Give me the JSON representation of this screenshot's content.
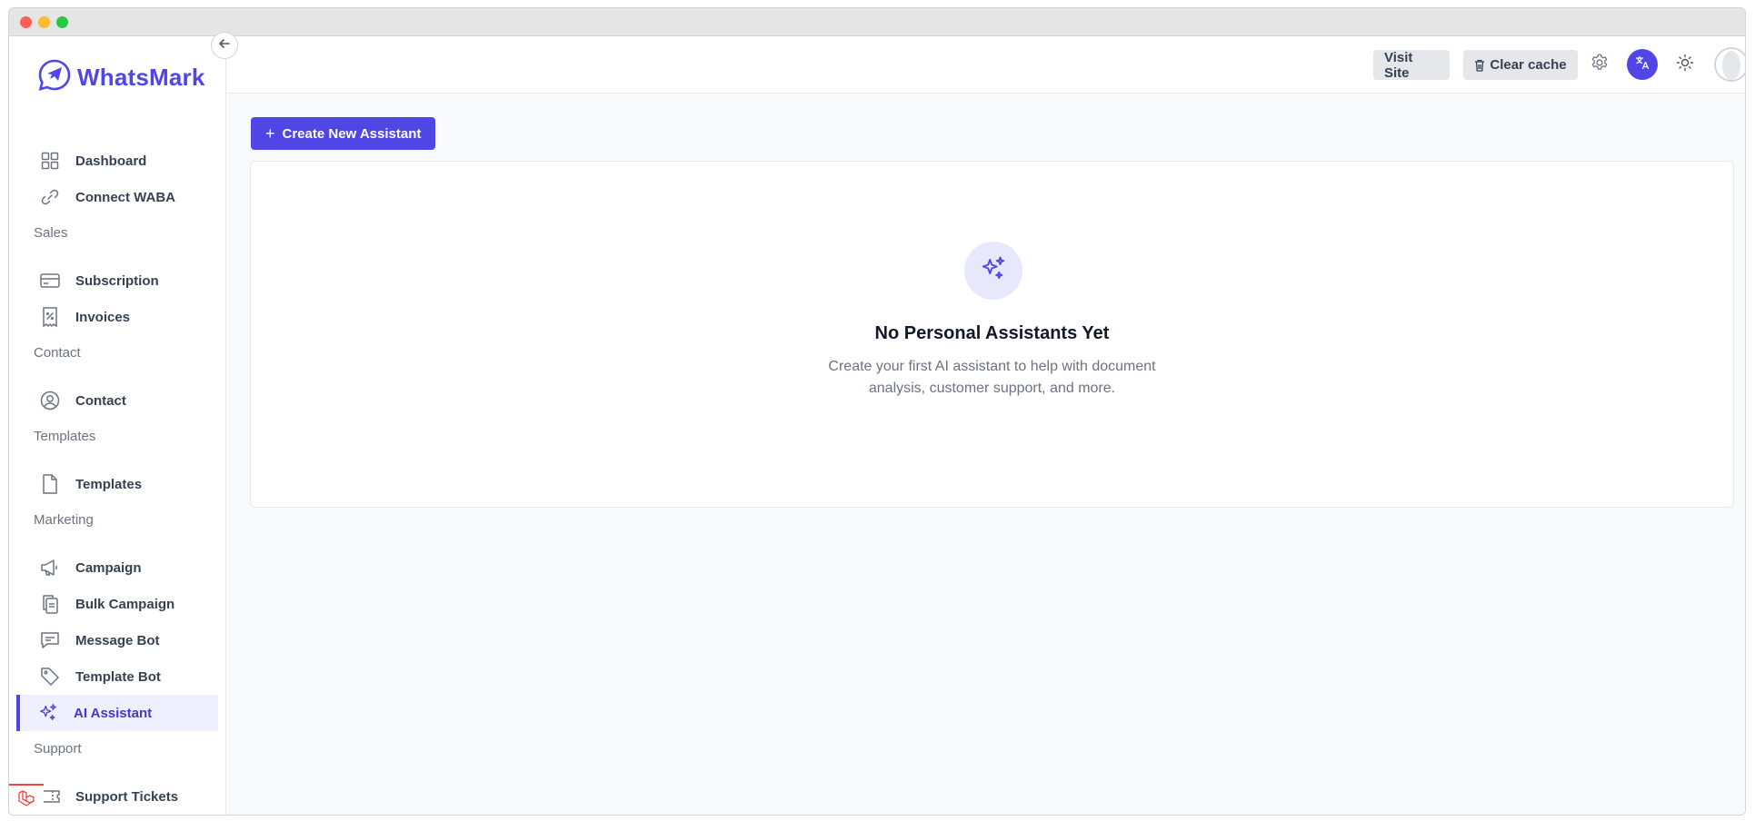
{
  "brand": {
    "name": "WhatsMark",
    "accent": "#4f46e5"
  },
  "sidebar": {
    "items": [
      {
        "key": "dashboard",
        "label": "Dashboard",
        "icon": "grid-icon"
      },
      {
        "key": "connect-waba",
        "label": "Connect WABA",
        "icon": "link-icon"
      },
      {
        "key": "sales-section",
        "label": "Sales",
        "type": "section"
      },
      {
        "key": "subscription",
        "label": "Subscription",
        "icon": "credit-card-icon"
      },
      {
        "key": "invoices",
        "label": "Invoices",
        "icon": "receipt-icon"
      },
      {
        "key": "contact-section",
        "label": "Contact",
        "type": "section"
      },
      {
        "key": "contact",
        "label": "Contact",
        "icon": "user-circle-icon"
      },
      {
        "key": "templates-section",
        "label": "Templates",
        "type": "section"
      },
      {
        "key": "templates",
        "label": "Templates",
        "icon": "document-icon"
      },
      {
        "key": "marketing-section",
        "label": "Marketing",
        "type": "section"
      },
      {
        "key": "campaign",
        "label": "Campaign",
        "icon": "megaphone-icon"
      },
      {
        "key": "bulk-campaign",
        "label": "Bulk Campaign",
        "icon": "clipboard-copy-icon"
      },
      {
        "key": "message-bot",
        "label": "Message Bot",
        "icon": "chat-bubble-icon"
      },
      {
        "key": "template-bot",
        "label": "Template Bot",
        "icon": "tag-icon"
      },
      {
        "key": "ai-assistant",
        "label": "AI Assistant",
        "icon": "sparkles-icon",
        "active": true
      },
      {
        "key": "support-section",
        "label": "Support",
        "type": "section"
      },
      {
        "key": "support-tickets",
        "label": "Support Tickets",
        "icon": "ticket-icon"
      }
    ]
  },
  "topbar": {
    "visit_site": "Visit Site",
    "clear_cache": "Clear cache"
  },
  "main": {
    "create_button": "Create New Assistant",
    "empty_state": {
      "title": "No Personal Assistants Yet",
      "description": "Create your first AI assistant to help with document analysis, customer support, and more."
    }
  }
}
